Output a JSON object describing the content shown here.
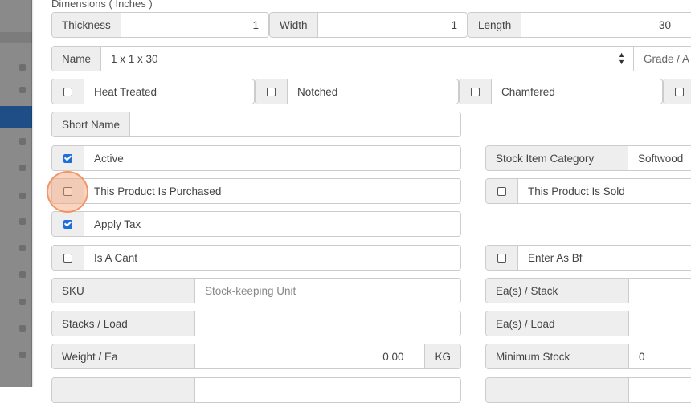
{
  "dimensions": {
    "section_label": "Dimensions ( Inches )",
    "thickness": {
      "label": "Thickness",
      "value": "1"
    },
    "width": {
      "label": "Width",
      "value": "1"
    },
    "length": {
      "label": "Length",
      "value": "30"
    }
  },
  "name": {
    "label": "Name",
    "value": "1 x 1 x 30",
    "grade_label": "Grade / A"
  },
  "flags": [
    {
      "label": "Heat Treated",
      "checked": false
    },
    {
      "label": "Notched",
      "checked": false
    },
    {
      "label": "Chamfered",
      "checked": false
    }
  ],
  "short_name": {
    "label": "Short Name",
    "value": ""
  },
  "active": {
    "label": "Active",
    "checked": true
  },
  "stock_item_category": {
    "label": "Stock Item Category",
    "value": "Softwood"
  },
  "purchased": {
    "label": "This Product Is Purchased",
    "checked": false
  },
  "sold": {
    "label": "This Product Is Sold",
    "checked": false
  },
  "apply_tax": {
    "label": "Apply Tax",
    "checked": true
  },
  "is_a_cant": {
    "label": "Is A Cant",
    "checked": false
  },
  "enter_as_bf": {
    "label": "Enter As Bf",
    "checked": false
  },
  "sku": {
    "label": "SKU",
    "placeholder": "Stock-keeping Unit"
  },
  "ea_per_stack": {
    "label": "Ea(s) / Stack",
    "value": ""
  },
  "stacks_per_load": {
    "label": "Stacks / Load",
    "value": ""
  },
  "ea_per_load": {
    "label": "Ea(s) / Load",
    "value": ""
  },
  "weight_per_ea": {
    "label": "Weight / Ea",
    "value": "0.00",
    "unit": "KG"
  },
  "minimum_stock": {
    "label": "Minimum Stock",
    "value": "0"
  },
  "colors": {
    "accent": "#1e6fd9",
    "click_marker": "#f5a06e"
  }
}
